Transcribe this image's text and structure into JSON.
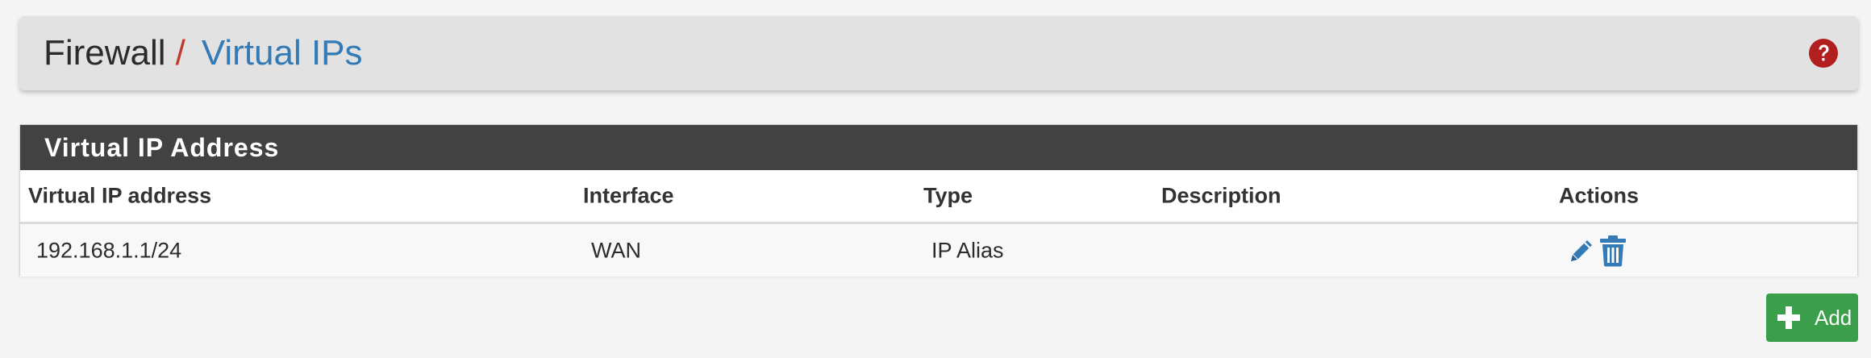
{
  "breadcrumb": {
    "root": "Firewall",
    "separator": "/",
    "current": "Virtual IPs"
  },
  "help": {
    "icon": "question-circle-icon",
    "color": "#b21f1f"
  },
  "panel": {
    "title": "Virtual IP Address",
    "columns": [
      "Virtual IP address",
      "Interface",
      "Type",
      "Description",
      "Actions"
    ],
    "rows": [
      {
        "address": "192.168.1.1/24",
        "interface": "WAN",
        "type": "IP Alias",
        "description": "",
        "actions": [
          "pencil-icon",
          "trash-icon"
        ]
      }
    ]
  },
  "add_button": {
    "label": "Add",
    "icon": "plus-icon",
    "color": "#3a9e4a"
  },
  "colors": {
    "accent": "#337ab7",
    "separator": "#c0392b",
    "panel_heading": "#424242"
  }
}
